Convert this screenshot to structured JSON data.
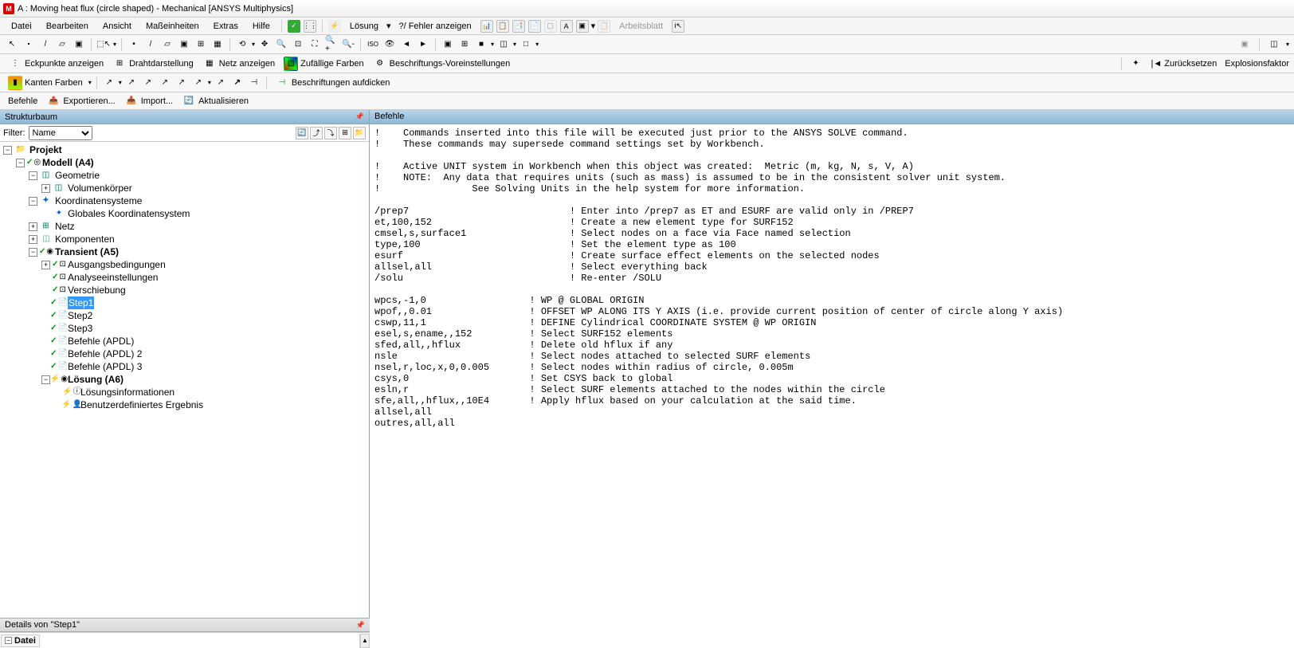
{
  "title": "A : Moving heat flux (circle shaped) - Mechanical [ANSYS Multiphysics]",
  "menu": {
    "datei": "Datei",
    "bearbeiten": "Bearbeiten",
    "ansicht": "Ansicht",
    "masseinheiten": "Maßeinheiten",
    "extras": "Extras",
    "hilfe": "Hilfe",
    "loesung": "Lösung",
    "fehler_anzeigen": "?/ Fehler anzeigen",
    "arbeitsblatt": "Arbeitsblatt"
  },
  "toolbar2": {
    "eckpunkte": "Eckpunkte anzeigen",
    "drahtdarstellung": "Drahtdarstellung",
    "netz_anzeigen": "Netz anzeigen",
    "zufaellige": "Zufällige Farben",
    "beschriftungs": "Beschriftungs-Voreinstellungen",
    "zuruecksetzen": "Zurücksetzen",
    "explosionsfaktor": "Explosionsfaktor"
  },
  "toolbar3": {
    "kanten_farben": "Kanten Farben",
    "beschriftungen": "Beschriftungen aufdicken"
  },
  "toolbar4": {
    "befehle": "Befehle",
    "exportieren": "Exportieren...",
    "import": "Import...",
    "aktualisieren": "Aktualisieren"
  },
  "strukturbaum": {
    "title": "Strukturbaum",
    "filter_label": "Filter:",
    "filter_value": "Name",
    "nodes": {
      "projekt": "Projekt",
      "modell": "Modell (A4)",
      "geometrie": "Geometrie",
      "volumenkoerper": "Volumenkörper",
      "koordinatensysteme": "Koordinatensysteme",
      "globales_ks": "Globales Koordinatensystem",
      "netz": "Netz",
      "komponenten": "Komponenten",
      "transient": "Transient (A5)",
      "ausgangsbedingungen": "Ausgangsbedingungen",
      "analyseeinstellungen": "Analyseeinstellungen",
      "verschiebung": "Verschiebung",
      "step1": "Step1",
      "step2": "Step2",
      "step3": "Step3",
      "befehle_apdl": "Befehle (APDL)",
      "befehle_apdl2": "Befehle (APDL) 2",
      "befehle_apdl3": "Befehle (APDL) 3",
      "loesung": "Lösung (A6)",
      "loesungsinfo": "Lösungsinformationen",
      "benutzerdefiniert": "Benutzerdefiniertes Ergebnis"
    }
  },
  "befehle": {
    "title": "Befehle",
    "code": "!    Commands inserted into this file will be executed just prior to the ANSYS SOLVE command.\n!    These commands may supersede command settings set by Workbench.\n\n!    Active UNIT system in Workbench when this object was created:  Metric (m, kg, N, s, V, A)\n!    NOTE:  Any data that requires units (such as mass) is assumed to be in the consistent solver unit system.\n!                See Solving Units in the help system for more information.\n\n/prep7                            ! Enter into /prep7 as ET and ESURF are valid only in /PREP7\net,100,152                        ! Create a new element type for SURF152\ncmsel,s,surface1                  ! Select nodes on a face via Face named selection\ntype,100                          ! Set the element type as 100\nesurf                             ! Create surface effect elements on the selected nodes\nallsel,all                        ! Select everything back\n/solu                             ! Re-enter /SOLU\n\nwpcs,-1,0                  ! WP @ GLOBAL ORIGIN\nwpof,,0.01                 ! OFFSET WP ALONG ITS Y AXIS (i.e. provide current position of center of circle along Y axis)\ncswp,11,1                  ! DEFINE Cylindrical COORDINATE SYSTEM @ WP ORIGIN\nesel,s,ename,,152          ! Select SURF152 elements\nsfed,all,,hflux            ! Delete old hflux if any\nnsle                       ! Select nodes attached to selected SURF elements\nnsel,r,loc,x,0,0.005       ! Select nodes within radius of circle, 0.005m\ncsys,0                     ! Set CSYS back to global\nesln,r                     ! Select SURF elements attached to the nodes within the circle\nsfe,all,,hflux,,10E4       ! Apply hflux based on your calculation at the said time.\nallsel,all\noutres,all,all"
  },
  "details": {
    "title": "Details von \"Step1\"",
    "datei": "Datei"
  }
}
